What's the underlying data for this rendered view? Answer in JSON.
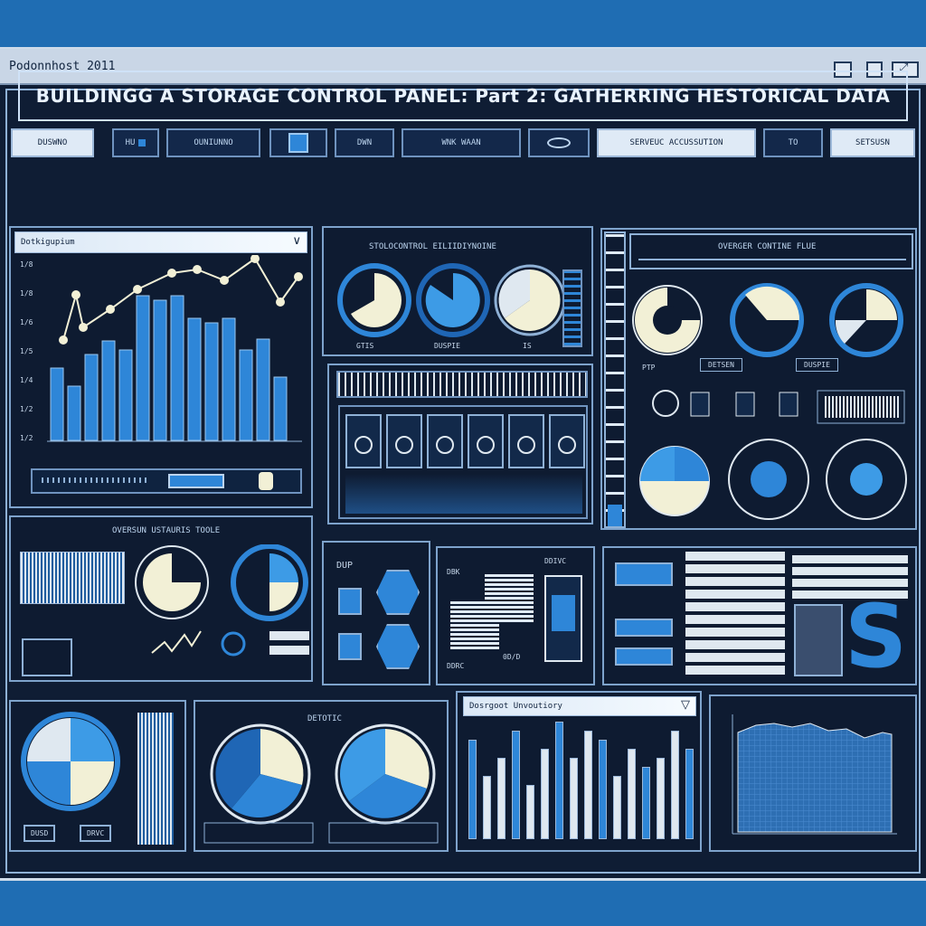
{
  "window": {
    "title": "Podonnhost 2011"
  },
  "header": {
    "title": "BUILDINGG A STORAGE CONTROL PANEL: Part 2: GATHERRING HESTORICAL DATA"
  },
  "toolbar": {
    "items": [
      "DUSWNO",
      "HU",
      "OUNIUNNO",
      "DWN",
      "WNK WAAN",
      "",
      "SERVEUC ACCUSSUTION",
      "TO",
      "SETSUSN"
    ]
  },
  "panels": {
    "history": {
      "dropdown": "Dotkigupium",
      "y_ticks": [
        "1/8",
        "1/8",
        "1/6",
        "1/5",
        "1/4",
        "1/2",
        "1/2"
      ]
    },
    "pies_top": {
      "title": "STOLOCONTROL EILIIDIYNOINE",
      "labels": [
        "GTIS",
        "DUSPIE",
        "IS"
      ]
    },
    "right_top": {
      "title": "OVERGER CONTINE FLUE",
      "labels": [
        "PTP",
        "DETSEN",
        "DUSPIE"
      ]
    },
    "left_mid": {
      "title": "OVERSUN USTAURIS TOOLE"
    },
    "disk": {
      "labels": [
        "DUP",
        "DBK",
        "DDIVC",
        "DDRC",
        "0D/D"
      ]
    },
    "bottom_bars": {
      "dropdown": "Dosrgoot Unvoutiory"
    },
    "bottom_pies": {
      "title": "DETOTIC"
    },
    "bottom_left": {
      "labels": [
        "DUSD",
        "DRVC"
      ]
    }
  },
  "colors": {
    "accent": "#2e86d8",
    "bg": "#0e1b31",
    "line": "#7ea3cc",
    "cream": "#f2f0d6"
  }
}
